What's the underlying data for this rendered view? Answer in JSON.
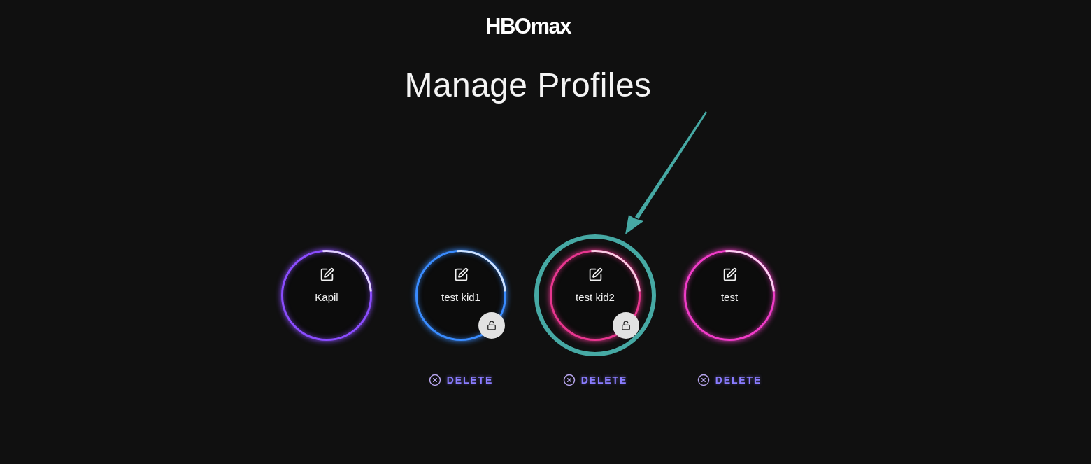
{
  "logo": "HBOmax",
  "title": "Manage Profiles",
  "profiles": [
    {
      "name": "Kapil",
      "color": "#8b4dff",
      "lock_badge": false,
      "highlighted": false
    },
    {
      "name": "test kid1",
      "color": "#3a8cff",
      "lock_badge": true,
      "highlighted": false,
      "delete_label": "DELETE"
    },
    {
      "name": "test kid2",
      "color": "#e8368f",
      "lock_badge": true,
      "highlighted": true,
      "delete_label": "DELETE"
    },
    {
      "name": "test",
      "color": "#f03cc8",
      "lock_badge": false,
      "highlighted": false,
      "delete_label": "DELETE"
    }
  ]
}
